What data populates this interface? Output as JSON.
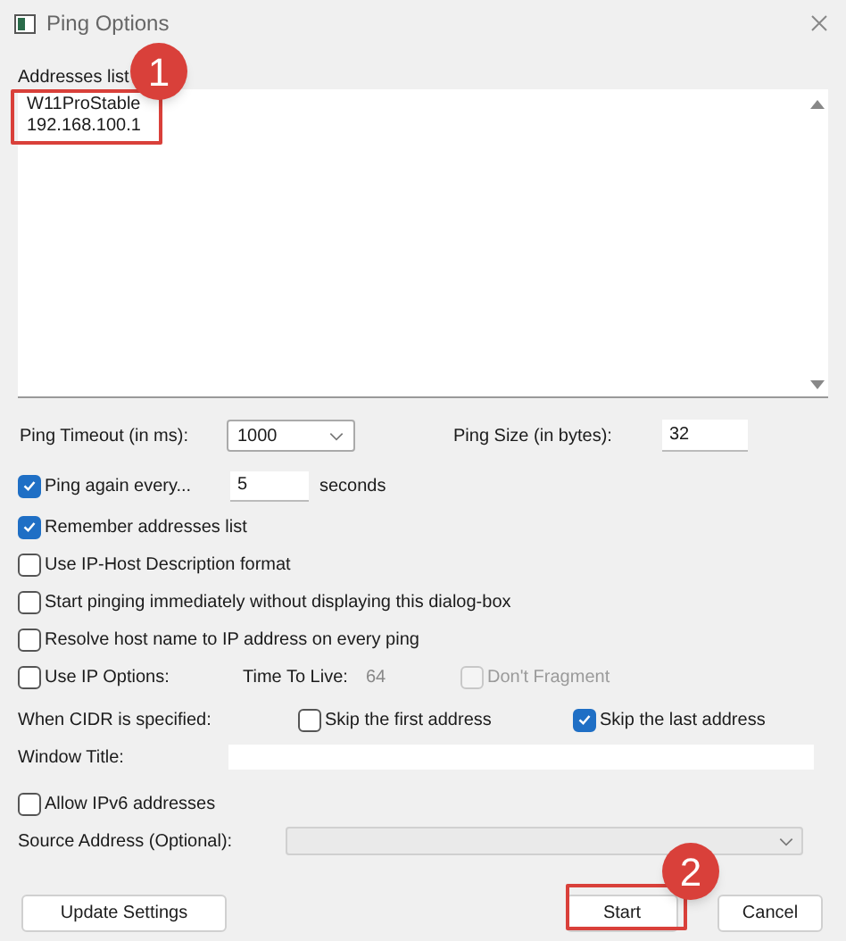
{
  "window": {
    "title": "Ping Options"
  },
  "addresses": {
    "label": "Addresses list",
    "lines": [
      "W11ProStable",
      "192.168.100.1"
    ]
  },
  "ping_timeout": {
    "label": "Ping Timeout (in ms):",
    "value": "1000"
  },
  "ping_size": {
    "label": "Ping Size (in bytes):",
    "value": "32"
  },
  "ping_again": {
    "label": "Ping again every...",
    "checked": true,
    "value": "5",
    "unit": "seconds"
  },
  "options": [
    {
      "label": "Remember addresses list",
      "checked": true
    },
    {
      "label": "Use IP-Host Description format",
      "checked": false
    },
    {
      "label": "Start pinging immediately without displaying this dialog-box",
      "checked": false
    },
    {
      "label": "Resolve host name to IP address on every ping",
      "checked": false
    }
  ],
  "ip_options": {
    "label": "Use IP Options:",
    "checked": false,
    "ttl_label": "Time To Live:",
    "ttl_value": "64",
    "dont_fragment": {
      "label": "Don't Fragment",
      "checked": false,
      "disabled": true
    }
  },
  "cidr": {
    "label": "When CIDR is specified:",
    "skip_first": {
      "label": "Skip the first address",
      "checked": false
    },
    "skip_last": {
      "label": "Skip the last address",
      "checked": true
    }
  },
  "window_title": {
    "label": "Window Title:"
  },
  "ipv6": {
    "label": "Allow IPv6 addresses",
    "checked": false
  },
  "source_address": {
    "label": "Source Address (Optional):",
    "disabled": true
  },
  "buttons": [
    {
      "label": "Update Settings"
    },
    {
      "label": "Start"
    },
    {
      "label": "Cancel"
    }
  ],
  "callouts": [
    {
      "number": "1"
    },
    {
      "number": "2"
    }
  ]
}
